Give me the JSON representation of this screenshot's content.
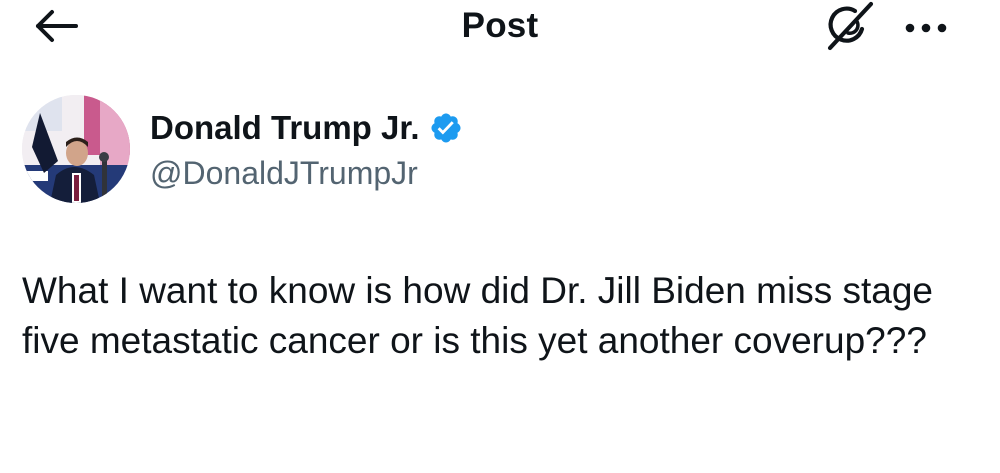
{
  "header": {
    "title": "Post",
    "back_icon": "arrow-left-icon",
    "grok_icon": "grok-icon",
    "more_icon": "ellipsis-icon"
  },
  "author": {
    "name": "Donald Trump Jr.",
    "handle": "@DonaldJTrumpJr",
    "verified": true,
    "verified_color": "#1d9bf0"
  },
  "post": {
    "text": "What I want to know is how did Dr. Jill Biden miss stage five metastatic cancer or is this yet another coverup???"
  },
  "colors": {
    "primary_text": "#0f1419",
    "secondary_text": "#536471",
    "background": "#ffffff"
  }
}
